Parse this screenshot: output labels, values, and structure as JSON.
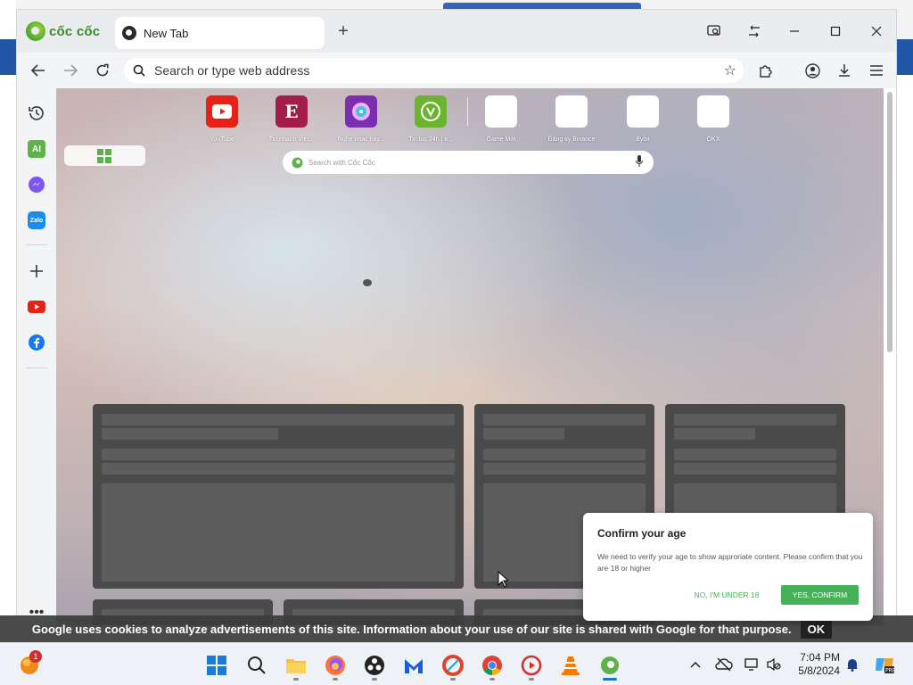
{
  "browser": {
    "brand": "cốc cốc",
    "tab_title": "New Tab",
    "address_placeholder": "Search or type web address"
  },
  "shortcuts": [
    {
      "label": "YouTube",
      "color": "#e62117",
      "icon": "youtube-icon"
    },
    {
      "label": "Tin nhanh Việt...",
      "color": "#a31d4c",
      "glyph": "E",
      "icon": "e-icon"
    },
    {
      "label": "Nghe nhạc hay...",
      "color": "#7b2fb0",
      "icon": "music-disc-icon"
    },
    {
      "label": "Tin tuc 24h | ti...",
      "color": "#6ab42f",
      "glyph": "V",
      "icon": "v-icon"
    },
    {
      "label": "Game Mới",
      "color": "#ffffff",
      "icon": "blank-tile-icon"
    },
    {
      "label": "Đăng ký Binance",
      "color": "#ffffff",
      "icon": "blank-tile-icon"
    },
    {
      "label": "Bybit",
      "color": "#ffffff",
      "icon": "blank-tile-icon"
    },
    {
      "label": "OKX",
      "color": "#ffffff",
      "icon": "blank-tile-icon"
    }
  ],
  "newtab_search_placeholder": "Search with Cốc Cốc",
  "cookie": {
    "text": "Google uses cookies to analyze advertisements of this site. Information about your use of our site is shared with Google for that purpose.",
    "ok": "OK"
  },
  "age_dialog": {
    "title": "Confirm your age",
    "body": "We need to verify your age to show approriate content. Please confirm that you are 18 or higher",
    "decline": "NO, I'M UNDER 18",
    "confirm": "YES, CONFIRM",
    "accent_color": "#45b25a"
  },
  "taskbar": {
    "notification_count": "1",
    "time": "7:04 PM",
    "date": "5/8/2024"
  }
}
